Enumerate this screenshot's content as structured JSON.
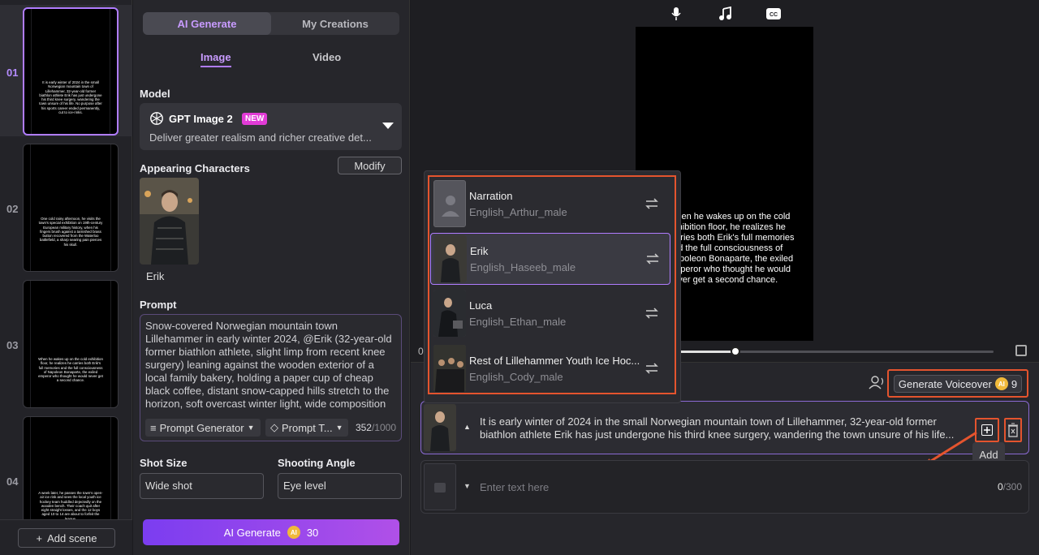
{
  "scenes": [
    {
      "num": "01",
      "text": "It is early winter of 2024 in the small Norwegian mountain town of Lillehammer, 32-year-old former biathlon athlete Erik has just undergone his third knee surgery, wandering the town unsure of his life. No purpose after his sports career ended permanently, cut to ice-rinks."
    },
    {
      "num": "02",
      "text": "One cold rainy afternoon, he visits the town's special exhibition on 19th-century European military history, when his fingers brush against a tarnished brass button recovered from the Waterloo battlefield, a sharp searing pain pierces his skull."
    },
    {
      "num": "03",
      "text": "When he wakes up on the cold exhibition floor, he realizes he carries both Erik's full memories and the full consciousness of Napoleon Bonaparte, the exiled emperor who thought he would never get a second chance."
    },
    {
      "num": "04",
      "text": "A week later, he passes the town's open-air ice rink and sees the local youth ice hockey team huddled dejectedly on the wooden bench. Their coach quit after eight straight losses, and the 12 boys aged 10 to 14 are about to forfeit the league."
    }
  ],
  "add_scene_label": "Add scene",
  "tabs": {
    "ai_generate": "AI Generate",
    "my_creations": "My Creations",
    "image": "Image",
    "video": "Video"
  },
  "model": {
    "label": "Model",
    "name": "GPT Image 2",
    "badge": "NEW",
    "description": "Deliver greater realism and richer creative det..."
  },
  "characters": {
    "label": "Appearing Characters",
    "modify": "Modify",
    "name": "Erik"
  },
  "prompt": {
    "label": "Prompt",
    "text": "Snow-covered Norwegian mountain town Lillehammer in early winter 2024, @Erik (32-year-old former biathlon athlete, slight limp from recent knee surgery) leaning against the wooden exterior of a local family bakery, holding a paper cup of cheap black coffee, distant snow-capped hills stretch to the horizon, soft overcast winter light, wide composition",
    "generator": "Prompt Generator",
    "template": "Prompt T...",
    "count": "352",
    "max": "/1000"
  },
  "shot": {
    "size_label": "Shot Size",
    "size_value": "Wide shot",
    "angle_label": "Shooting Angle",
    "angle_value": "Eye level"
  },
  "generate": {
    "label": "AI Generate",
    "cost": "30",
    "coin": "AI"
  },
  "preview": {
    "text": "When he wakes up on the cold exhibition floor, he realizes he carries both Erik's full memories and the full consciousness of Napoleon Bonaparte, the exiled emperor who thought he would never get a second chance.",
    "time": "0"
  },
  "voiceover": {
    "label": "Generate Voiceover",
    "cost": "9"
  },
  "script_line": {
    "text": "It is early winter of 2024 in the small Norwegian mountain town of Lillehammer, 32-year-old former biathlon athlete Erik has just undergone his third knee surgery, wandering the town unsure of his life..."
  },
  "tooltip": "Add",
  "new_line": {
    "placeholder": "Enter text here",
    "count": "0",
    "max": "/300"
  },
  "voices": [
    {
      "name": "Narration",
      "voice": "English_Arthur_male"
    },
    {
      "name": "Erik",
      "voice": "English_Haseeb_male"
    },
    {
      "name": "Luca",
      "voice": "English_Ethan_male"
    },
    {
      "name": "Rest of Lillehammer Youth Ice Hoc...",
      "voice": "English_Cody_male"
    }
  ],
  "colors": {
    "accent": "#b07cff",
    "highlight": "#e4542e",
    "coin": "#f0b93a"
  }
}
